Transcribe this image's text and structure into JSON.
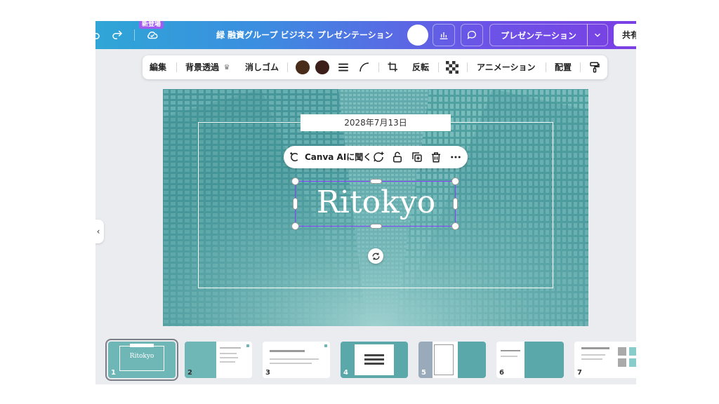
{
  "header": {
    "badge": "新登場",
    "title": "緑 融資グループ ビジネス プレゼンテーション",
    "present_label": "プレゼンテーション",
    "share_label": "共有"
  },
  "toolbar": {
    "edit": "編集",
    "bg_remove": "背景透過",
    "eraser": "消しゴム",
    "flip": "反転",
    "animation": "アニメーション",
    "arrange": "配置",
    "colors": [
      "#4a2c1a",
      "#3d1f1a"
    ]
  },
  "slide": {
    "date": "2028年7月13日",
    "title": "Ritokyo",
    "ai_label": "Canva AIに聞く"
  },
  "filmstrip": {
    "thumbnails": [
      {
        "number": "1",
        "title": "Ritokyo"
      },
      {
        "number": "2",
        "title": ""
      },
      {
        "number": "3",
        "title": ""
      },
      {
        "number": "4",
        "title": ""
      },
      {
        "number": "5",
        "title": ""
      },
      {
        "number": "6",
        "title": ""
      },
      {
        "number": "7",
        "title": ""
      }
    ]
  },
  "colors": {
    "accent": "#8b3dff",
    "slide_teal": "#5aa8aa"
  }
}
